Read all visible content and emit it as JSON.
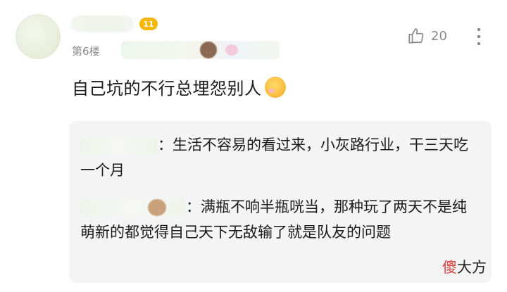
{
  "comment": {
    "level": "11",
    "floor": "第6楼",
    "likes": "20",
    "text": "自己坑的不行总埋怨别人"
  },
  "replies": [
    {
      "text": "：生活不容易的看过来，小灰路行业，干三天吃一个月"
    },
    {
      "text": "：满瓶不响半瓶咣当，那种玩了两天不是纯萌新的都觉得自己天下无敌输了就是队友的问题"
    }
  ],
  "watermark": {
    "part1": "傻",
    "part2": "大方"
  },
  "icons": {
    "like": "thumbs-up-icon",
    "more": "more-vertical-icon",
    "emoji": "angry-face-emoji"
  },
  "colors": {
    "badge": "#f5b800",
    "reply_bg": "#f4f4f5",
    "watermark_red": "#e03c3c"
  }
}
